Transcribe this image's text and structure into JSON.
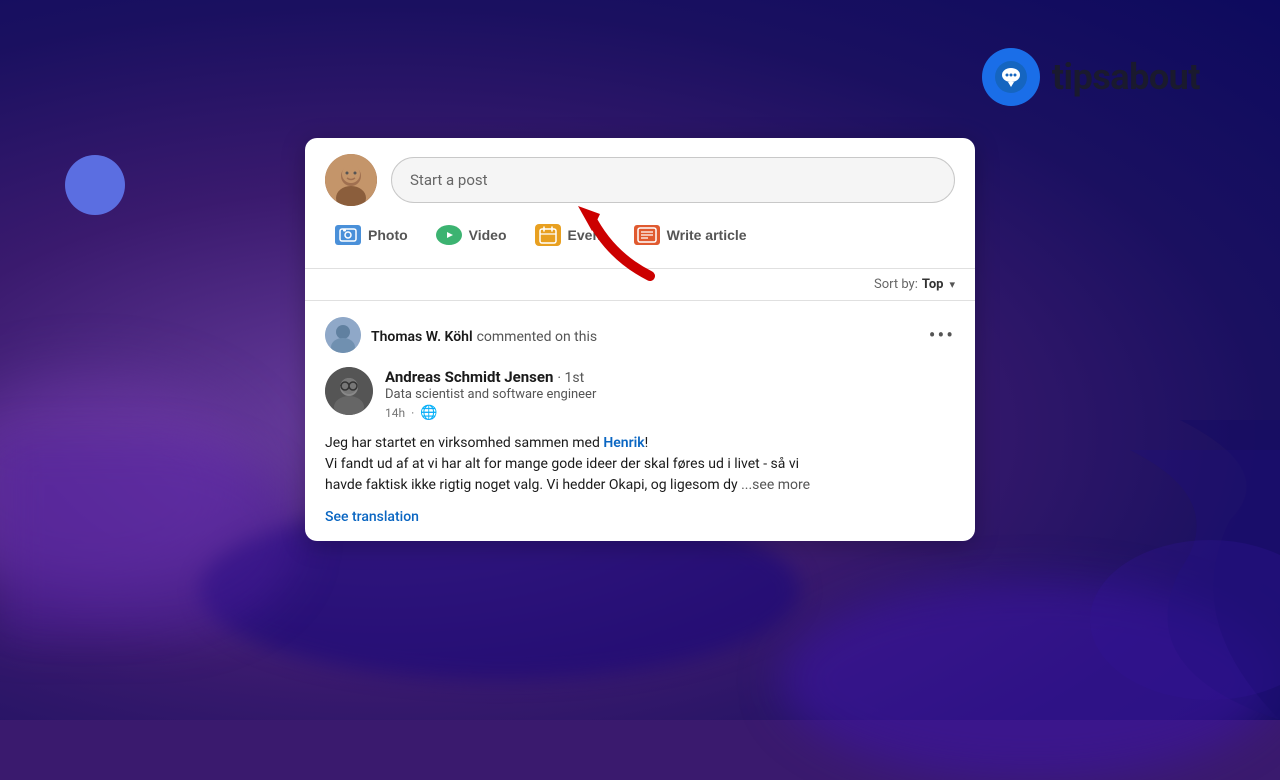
{
  "background": {
    "color": "#3a1a6e"
  },
  "logo": {
    "text": "tipsabout",
    "icon_description": "chat-bubble-icon"
  },
  "post_creator": {
    "placeholder": "Start a post",
    "avatar_alt": "User avatar"
  },
  "actions": [
    {
      "id": "photo",
      "label": "Photo",
      "icon": "photo-icon",
      "color": "#4a90d9"
    },
    {
      "id": "video",
      "label": "Video",
      "icon": "video-icon",
      "color": "#3cb371"
    },
    {
      "id": "event",
      "label": "Event",
      "icon": "event-icon",
      "color": "#e8a020"
    },
    {
      "id": "article",
      "label": "Write article",
      "icon": "article-icon",
      "color": "#e05a30"
    }
  ],
  "sort": {
    "label": "Sort by:",
    "value": "Top"
  },
  "feed_item": {
    "commentor": {
      "name": "Thomas W. Köhl",
      "action": "commented on this"
    },
    "author": {
      "name": "Andreas Schmidt Jensen",
      "degree": "1st",
      "title": "Data scientist and software engineer",
      "time": "14h",
      "visibility": "🌐"
    },
    "content": {
      "line1": "Jeg har startet en virksomhed sammen med ",
      "link_text": "Henrik",
      "line1_end": "!",
      "line2": "Vi fandt ud af at vi har alt for mange gode ideer der skal føres ud i livet - så vi",
      "line3": "havde faktisk ikke rigtig noget valg. Vi hedder Okapi, og ligesom dy",
      "see_more": "...see more"
    },
    "see_translation": "See translation"
  }
}
